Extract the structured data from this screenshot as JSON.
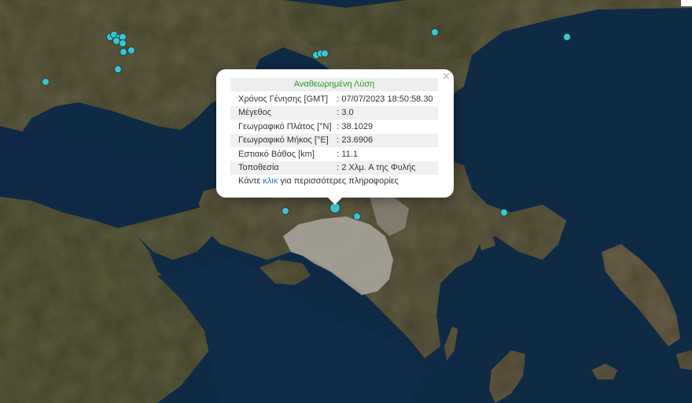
{
  "map": {
    "colors": {
      "sea": "#0f2a45",
      "land": "#5e5a3f",
      "city": "#b0aba3",
      "marker": "#3cc7d0",
      "marker_stroke": "#1f3e4c"
    },
    "marker_icon": "earthquake-marker-icon"
  },
  "popup": {
    "title": "Αναθεωρημένη Λύση",
    "close": "×",
    "rows": [
      {
        "label": "Χρόνος Γένησης [GMT]",
        "value": ": 07/07/2023 18:50:58.30"
      },
      {
        "label": "Μέγεθος",
        "value": ": 3.0"
      },
      {
        "label": "Γεωγραφικό Πλάτος [°N]",
        "value": ": 38.1029"
      },
      {
        "label": "Γεωγραφικό Μήκος [°E]",
        "value": ": 23.6906"
      },
      {
        "label": "Εστιακό Βάθος [km]",
        "value": ": 11.1"
      },
      {
        "label": "Τοποθεσία",
        "value": ": 2 Χλμ. Α της Φυλής"
      }
    ],
    "more_prefix": "Κάντε ",
    "more_link": "κλικ",
    "more_suffix": " για περισσότερες πληροφορίες"
  }
}
